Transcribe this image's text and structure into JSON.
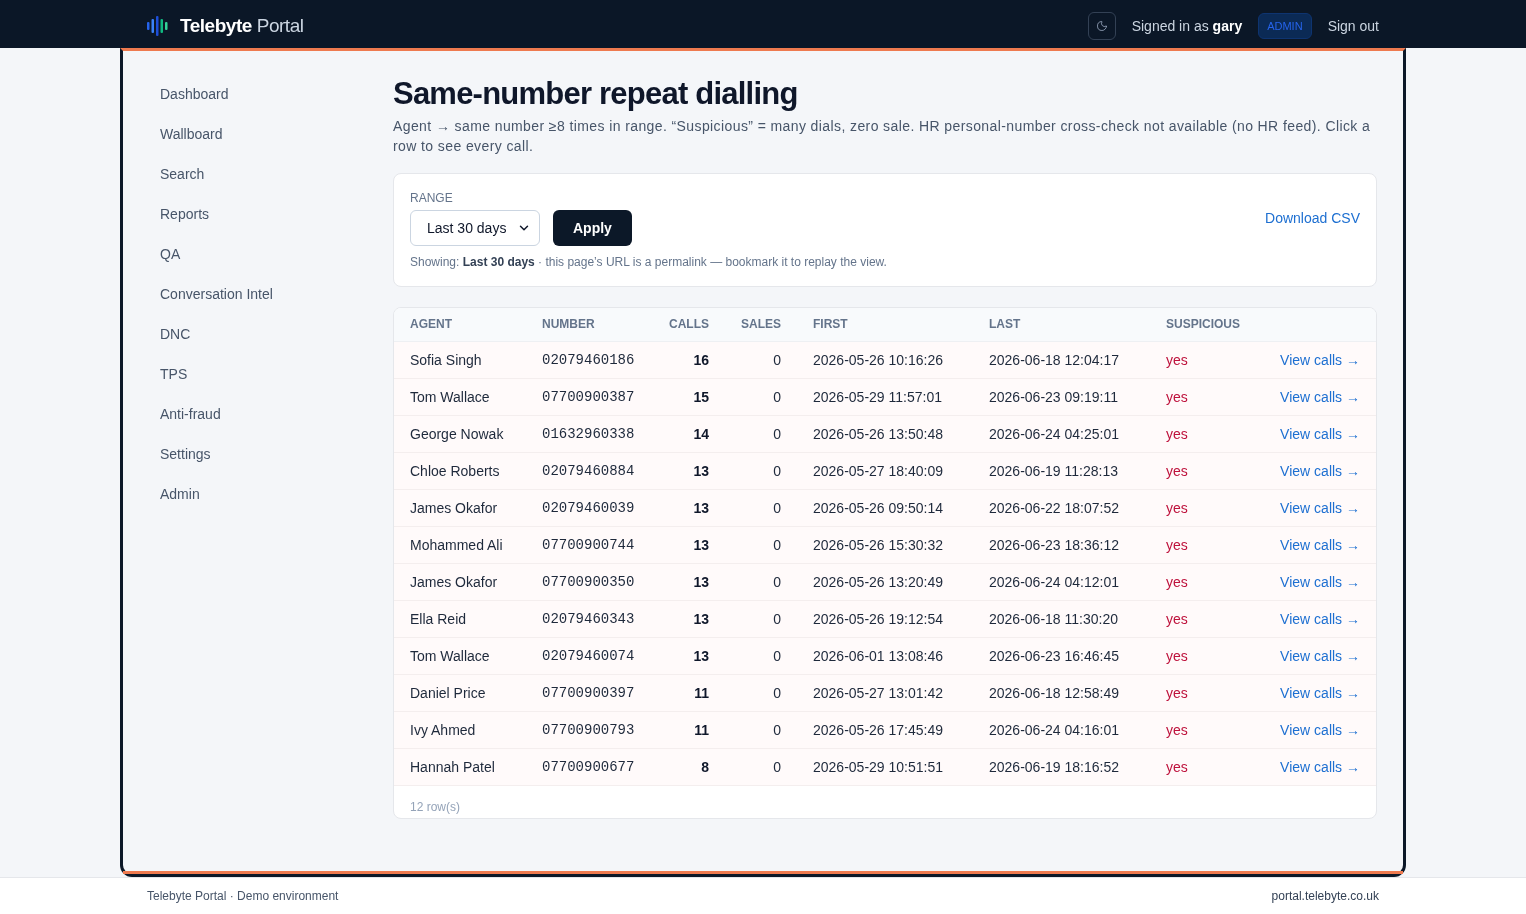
{
  "header": {
    "brand": "**Telebyte** Portal",
    "signed_in": "Signed in as **gary**",
    "role_badge": "ADMIN",
    "sign_out": "Sign out"
  },
  "sidebar": {
    "items": [
      {
        "label": "Dashboard",
        "selected": false
      },
      {
        "label": "Wallboard",
        "selected": false
      },
      {
        "label": "Search",
        "selected": false
      },
      {
        "label": "Reports",
        "selected": false
      },
      {
        "label": "QA",
        "selected": false
      },
      {
        "label": "Conversation Intel",
        "selected": false
      },
      {
        "label": "DNC",
        "selected": false
      },
      {
        "label": "TPS",
        "selected": false
      },
      {
        "label": "Anti-fraud",
        "selected": false
      },
      {
        "label": "Settings",
        "selected": false
      },
      {
        "label": "Admin",
        "selected": false
      }
    ]
  },
  "page": {
    "title": "Same-number repeat dialling",
    "description": "Agent → same number ≥8 times in range. “Suspicious” = many dials, zero sale. HR personal-number cross-check not available (no HR feed). Click a row to see every call."
  },
  "filters": {
    "range_label": "RANGE",
    "range_value": "Last 30 days",
    "apply": "Apply",
    "download": "Download CSV",
    "note": "Showing: **Last 30 days** · this page’s URL is a permalink — bookmark it to replay the view."
  },
  "table": {
    "columns": [
      "AGENT",
      "NUMBER",
      "CALLS",
      "SALES",
      "FIRST",
      "LAST",
      "SUSPICIOUS"
    ],
    "rows": [
      {
        "agent": "Sofia Singh",
        "number": "02079460186",
        "calls": "16",
        "sales": "0",
        "first": "2026-05-26 10:16:26",
        "last": "2026-06-18 12:04:17",
        "suspicious": "yes",
        "link": "View calls →"
      },
      {
        "agent": "Tom Wallace",
        "number": "07700900387",
        "calls": "15",
        "sales": "0",
        "first": "2026-05-29 11:57:01",
        "last": "2026-06-23 09:19:11",
        "suspicious": "yes",
        "link": "View calls →"
      },
      {
        "agent": "George Nowak",
        "number": "01632960338",
        "calls": "14",
        "sales": "0",
        "first": "2026-05-26 13:50:48",
        "last": "2026-06-24 04:25:01",
        "suspicious": "yes",
        "link": "View calls →"
      },
      {
        "agent": "Chloe Roberts",
        "number": "02079460884",
        "calls": "13",
        "sales": "0",
        "first": "2026-05-27 18:40:09",
        "last": "2026-06-19 11:28:13",
        "suspicious": "yes",
        "link": "View calls →"
      },
      {
        "agent": "James Okafor",
        "number": "02079460039",
        "calls": "13",
        "sales": "0",
        "first": "2026-05-26 09:50:14",
        "last": "2026-06-22 18:07:52",
        "suspicious": "yes",
        "link": "View calls →"
      },
      {
        "agent": "Mohammed Ali",
        "number": "07700900744",
        "calls": "13",
        "sales": "0",
        "first": "2026-05-26 15:30:32",
        "last": "2026-06-23 18:36:12",
        "suspicious": "yes",
        "link": "View calls →"
      },
      {
        "agent": "James Okafor",
        "number": "07700900350",
        "calls": "13",
        "sales": "0",
        "first": "2026-05-26 13:20:49",
        "last": "2026-06-24 04:12:01",
        "suspicious": "yes",
        "link": "View calls →"
      },
      {
        "agent": "Ella Reid",
        "number": "02079460343",
        "calls": "13",
        "sales": "0",
        "first": "2026-05-26 19:12:54",
        "last": "2026-06-18 11:30:20",
        "suspicious": "yes",
        "link": "View calls →"
      },
      {
        "agent": "Tom Wallace",
        "number": "02079460074",
        "calls": "13",
        "sales": "0",
        "first": "2026-06-01 13:08:46",
        "last": "2026-06-23 16:46:45",
        "suspicious": "yes",
        "link": "View calls →"
      },
      {
        "agent": "Daniel Price",
        "number": "07700900397",
        "calls": "11",
        "sales": "0",
        "first": "2026-05-27 13:01:42",
        "last": "2026-06-18 12:58:49",
        "suspicious": "yes",
        "link": "View calls →"
      },
      {
        "agent": "Ivy Ahmed",
        "number": "07700900793",
        "calls": "11",
        "sales": "0",
        "first": "2026-05-26 17:45:49",
        "last": "2026-06-24 04:16:01",
        "suspicious": "yes",
        "link": "View calls →"
      },
      {
        "agent": "Hannah Patel",
        "number": "07700900677",
        "calls": "8",
        "sales": "0",
        "first": "2026-05-29 10:51:51",
        "last": "2026-06-19 18:16:52",
        "suspicious": "yes",
        "link": "View calls →"
      }
    ],
    "row_count": "12 row(s)"
  },
  "footer": {
    "left": "Telebyte Portal · Demo environment",
    "right": "portal.telebyte.co.uk"
  }
}
